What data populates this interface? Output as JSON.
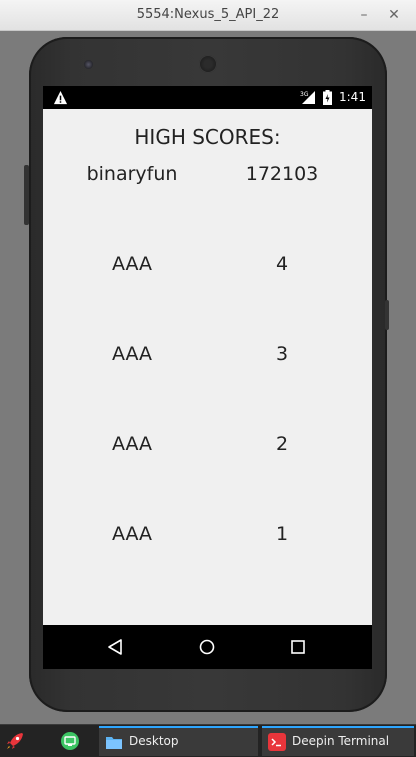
{
  "window": {
    "title": "5554:Nexus_5_API_22"
  },
  "statusbar": {
    "network": "3G",
    "time": "1:41"
  },
  "app": {
    "header": "HIGH SCORES:",
    "scores": [
      {
        "name": "binaryfun",
        "score": "172103"
      },
      {
        "name": "AAA",
        "score": "4"
      },
      {
        "name": "AAA",
        "score": "3"
      },
      {
        "name": "AAA",
        "score": "2"
      },
      {
        "name": "AAA",
        "score": "1"
      }
    ]
  },
  "taskbar": {
    "tasks": [
      {
        "label": "Desktop"
      },
      {
        "label": "Deepin Terminal"
      }
    ]
  },
  "colors": {
    "accent": "#2ea6ff",
    "app_bg": "#f0f0f0"
  }
}
